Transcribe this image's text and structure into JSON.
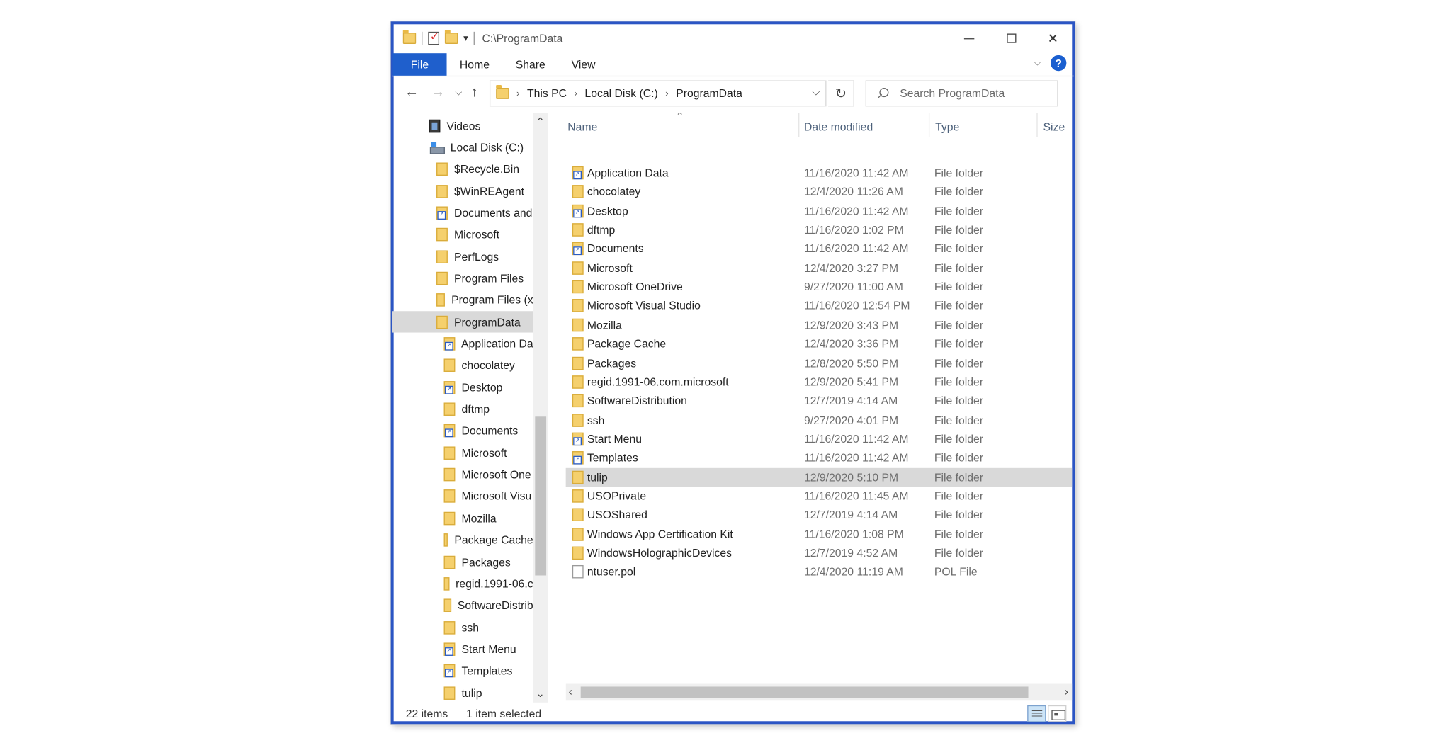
{
  "window": {
    "title": "C:\\ProgramData",
    "controls": {
      "minimize": "minimize",
      "maximize": "maximize",
      "close": "close"
    }
  },
  "ribbon": {
    "tabs": [
      "File",
      "Home",
      "Share",
      "View"
    ],
    "help_label": "?"
  },
  "address": {
    "crumbs": [
      "This PC",
      "Local Disk (C:)",
      "ProgramData"
    ],
    "search_placeholder": "Search ProgramData"
  },
  "nav_pane": {
    "items": [
      {
        "label": "Videos",
        "icon": "videos-icon",
        "indent": 1
      },
      {
        "label": "Local Disk (C:)",
        "icon": "disk-icon",
        "indent": 1
      },
      {
        "label": "$Recycle.Bin",
        "icon": "folder-icon",
        "indent": 2
      },
      {
        "label": "$WinREAgent",
        "icon": "folder-icon",
        "indent": 2
      },
      {
        "label": "Documents and",
        "icon": "folder-link-icon",
        "indent": 2
      },
      {
        "label": "Microsoft",
        "icon": "folder-icon",
        "indent": 2
      },
      {
        "label": "PerfLogs",
        "icon": "folder-icon",
        "indent": 2
      },
      {
        "label": "Program Files",
        "icon": "folder-icon",
        "indent": 2
      },
      {
        "label": "Program Files (x",
        "icon": "folder-icon",
        "indent": 2
      },
      {
        "label": "ProgramData",
        "icon": "folder-icon",
        "indent": 2,
        "selected": true
      },
      {
        "label": "Application Da",
        "icon": "folder-link-icon",
        "indent": 3
      },
      {
        "label": "chocolatey",
        "icon": "folder-icon",
        "indent": 3
      },
      {
        "label": "Desktop",
        "icon": "folder-link-icon",
        "indent": 3
      },
      {
        "label": "dftmp",
        "icon": "folder-icon",
        "indent": 3
      },
      {
        "label": "Documents",
        "icon": "folder-link-icon",
        "indent": 3
      },
      {
        "label": "Microsoft",
        "icon": "folder-icon",
        "indent": 3
      },
      {
        "label": "Microsoft One",
        "icon": "folder-icon",
        "indent": 3
      },
      {
        "label": "Microsoft Visu",
        "icon": "folder-icon",
        "indent": 3
      },
      {
        "label": "Mozilla",
        "icon": "folder-icon",
        "indent": 3
      },
      {
        "label": "Package Cache",
        "icon": "folder-icon",
        "indent": 3
      },
      {
        "label": "Packages",
        "icon": "folder-icon",
        "indent": 3
      },
      {
        "label": "regid.1991-06.c",
        "icon": "folder-icon",
        "indent": 3
      },
      {
        "label": "SoftwareDistrib",
        "icon": "folder-icon",
        "indent": 3
      },
      {
        "label": "ssh",
        "icon": "folder-icon",
        "indent": 3
      },
      {
        "label": "Start Menu",
        "icon": "folder-link-icon",
        "indent": 3
      },
      {
        "label": "Templates",
        "icon": "folder-link-icon",
        "indent": 3
      },
      {
        "label": "tulip",
        "icon": "folder-icon",
        "indent": 3
      }
    ]
  },
  "file_list": {
    "columns": {
      "name": "Name",
      "date": "Date modified",
      "type": "Type",
      "size": "Size"
    },
    "rows": [
      {
        "name": "Application Data",
        "date": "11/16/2020 11:42 AM",
        "type": "File folder",
        "icon": "folder-link-icon"
      },
      {
        "name": "chocolatey",
        "date": "12/4/2020 11:26 AM",
        "type": "File folder",
        "icon": "folder-icon"
      },
      {
        "name": "Desktop",
        "date": "11/16/2020 11:42 AM",
        "type": "File folder",
        "icon": "folder-link-icon"
      },
      {
        "name": "dftmp",
        "date": "11/16/2020 1:02 PM",
        "type": "File folder",
        "icon": "folder-icon"
      },
      {
        "name": "Documents",
        "date": "11/16/2020 11:42 AM",
        "type": "File folder",
        "icon": "folder-link-icon"
      },
      {
        "name": "Microsoft",
        "date": "12/4/2020 3:27 PM",
        "type": "File folder",
        "icon": "folder-icon"
      },
      {
        "name": "Microsoft OneDrive",
        "date": "9/27/2020 11:00 AM",
        "type": "File folder",
        "icon": "folder-icon"
      },
      {
        "name": "Microsoft Visual Studio",
        "date": "11/16/2020 12:54 PM",
        "type": "File folder",
        "icon": "folder-icon"
      },
      {
        "name": "Mozilla",
        "date": "12/9/2020 3:43 PM",
        "type": "File folder",
        "icon": "folder-icon"
      },
      {
        "name": "Package Cache",
        "date": "12/4/2020 3:36 PM",
        "type": "File folder",
        "icon": "folder-icon"
      },
      {
        "name": "Packages",
        "date": "12/8/2020 5:50 PM",
        "type": "File folder",
        "icon": "folder-icon"
      },
      {
        "name": "regid.1991-06.com.microsoft",
        "date": "12/9/2020 5:41 PM",
        "type": "File folder",
        "icon": "folder-icon"
      },
      {
        "name": "SoftwareDistribution",
        "date": "12/7/2019 4:14 AM",
        "type": "File folder",
        "icon": "folder-icon"
      },
      {
        "name": "ssh",
        "date": "9/27/2020 4:01 PM",
        "type": "File folder",
        "icon": "folder-icon"
      },
      {
        "name": "Start Menu",
        "date": "11/16/2020 11:42 AM",
        "type": "File folder",
        "icon": "folder-link-icon"
      },
      {
        "name": "Templates",
        "date": "11/16/2020 11:42 AM",
        "type": "File folder",
        "icon": "folder-link-icon"
      },
      {
        "name": "tulip",
        "date": "12/9/2020 5:10 PM",
        "type": "File folder",
        "icon": "folder-icon",
        "selected": true
      },
      {
        "name": "USOPrivate",
        "date": "11/16/2020 11:45 AM",
        "type": "File folder",
        "icon": "folder-icon"
      },
      {
        "name": "USOShared",
        "date": "12/7/2019 4:14 AM",
        "type": "File folder",
        "icon": "folder-icon"
      },
      {
        "name": "Windows App Certification Kit",
        "date": "11/16/2020 1:08 PM",
        "type": "File folder",
        "icon": "folder-icon"
      },
      {
        "name": "WindowsHolographicDevices",
        "date": "12/7/2019 4:52 AM",
        "type": "File folder",
        "icon": "folder-icon"
      },
      {
        "name": "ntuser.pol",
        "date": "12/4/2020 11:19 AM",
        "type": "POL File",
        "icon": "file-icon"
      }
    ]
  },
  "status_bar": {
    "item_count": "22 items",
    "selection": "1 item selected"
  },
  "colors": {
    "accent": "#1f5fcc",
    "selection": "#d9d9d9",
    "folder": "#f5d06d"
  }
}
